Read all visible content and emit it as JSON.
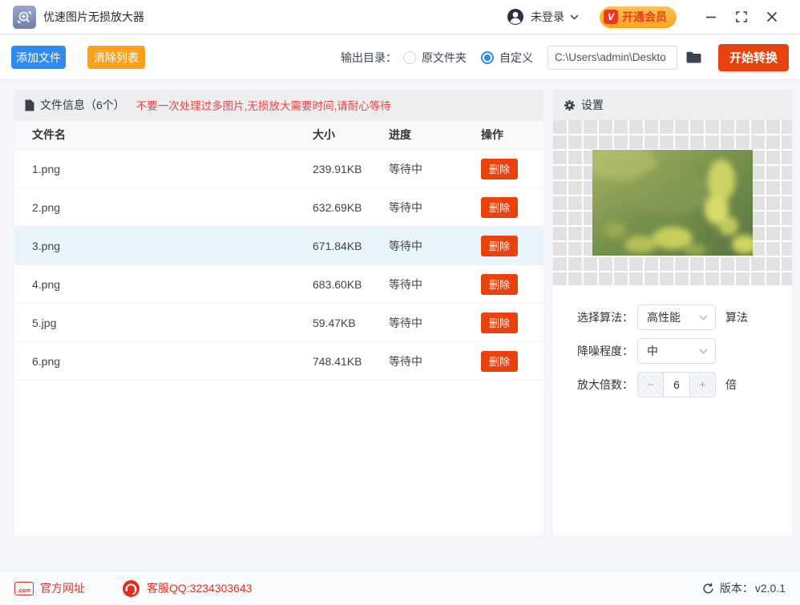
{
  "window": {
    "title": "优速图片无损放大器",
    "login_label": "未登录",
    "vip_label": "开通会员",
    "vip_badge": "V"
  },
  "toolbar": {
    "add_button": "添加文件",
    "clear_button": "清除列表",
    "output_dir_label": "输出目录：",
    "radio_original": "原文件夹",
    "radio_custom": "自定义",
    "path_value": "C:\\Users\\admin\\Deskto",
    "start_button": "开始转换"
  },
  "file_panel": {
    "title": "文件信息（6个）",
    "warning": "不要一次处理过多图片,无损放大需要时间,请耐心等待",
    "columns": [
      "文件名",
      "大小",
      "进度",
      "操作"
    ],
    "delete_label": "删除",
    "rows": [
      {
        "name": "1.png",
        "size": "239.91KB",
        "status": "等待中"
      },
      {
        "name": "2.png",
        "size": "632.69KB",
        "status": "等待中"
      },
      {
        "name": "3.png",
        "size": "671.84KB",
        "status": "等待中"
      },
      {
        "name": "4.png",
        "size": "683.60KB",
        "status": "等待中"
      },
      {
        "name": "5.jpg",
        "size": "59.47KB",
        "status": "等待中"
      },
      {
        "name": "6.png",
        "size": "748.41KB",
        "status": "等待中"
      }
    ]
  },
  "settings_panel": {
    "title": "设置",
    "algorithm_label": "选择算法：",
    "algorithm_value": "高性能",
    "algorithm_suffix": "算法",
    "denoise_label": "降噪程度：",
    "denoise_value": "中",
    "scale_label": "放大倍数：",
    "scale_minus": "−",
    "scale_value": "6",
    "scale_plus": "+",
    "scale_suffix": "倍"
  },
  "footer": {
    "dotcom_icon_text": ".com",
    "website_label": "官方网址",
    "qq_label": "客服QQ:3234303643",
    "version_label": "版本：",
    "version_value": "v2.0.1"
  },
  "colors": {
    "accent_blue": "#2d8bf0",
    "accent_orange": "#fea11a",
    "accent_red": "#e8420e",
    "warning_red": "#e84342",
    "footer_red": "#df2f20",
    "selected_row": "#e9f5fd",
    "vip_gradient": "#ffb236"
  }
}
